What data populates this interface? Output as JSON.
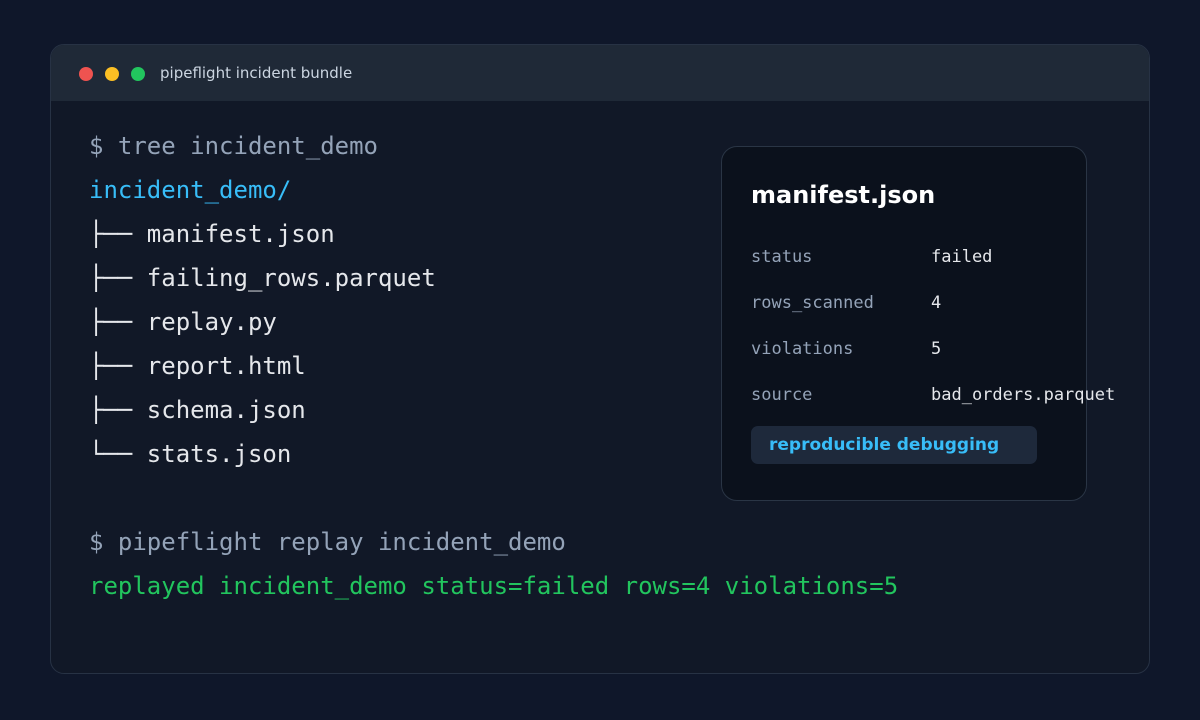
{
  "window": {
    "title": "pipeflight incident bundle"
  },
  "terminal": {
    "command1": "$ tree incident_demo",
    "root_dir": "incident_demo/",
    "tree": [
      {
        "branch": "├── ",
        "name": "manifest.json"
      },
      {
        "branch": "├── ",
        "name": "failing_rows.parquet"
      },
      {
        "branch": "├── ",
        "name": "replay.py"
      },
      {
        "branch": "├── ",
        "name": "report.html"
      },
      {
        "branch": "├── ",
        "name": "schema.json"
      },
      {
        "branch": "└── ",
        "name": "stats.json"
      }
    ],
    "command2": "$ pipeflight replay incident_demo",
    "output": "replayed incident_demo status=failed rows=4 violations=5"
  },
  "manifest_card": {
    "title": "manifest.json",
    "fields": [
      {
        "key": "status",
        "value": "failed"
      },
      {
        "key": "rows_scanned",
        "value": "4"
      },
      {
        "key": "violations",
        "value": "5"
      },
      {
        "key": "source",
        "value": "bad_orders.parquet"
      }
    ],
    "badge": "reproducible debugging"
  },
  "colors": {
    "background": "#0f172a",
    "window": "#111827",
    "titlebar": "#1f2937",
    "accent_blue": "#38bdf8",
    "success_green": "#22c55e",
    "close_red": "#ef5350",
    "minimize_yellow": "#fbbf24",
    "maximize_green": "#22c55e"
  }
}
